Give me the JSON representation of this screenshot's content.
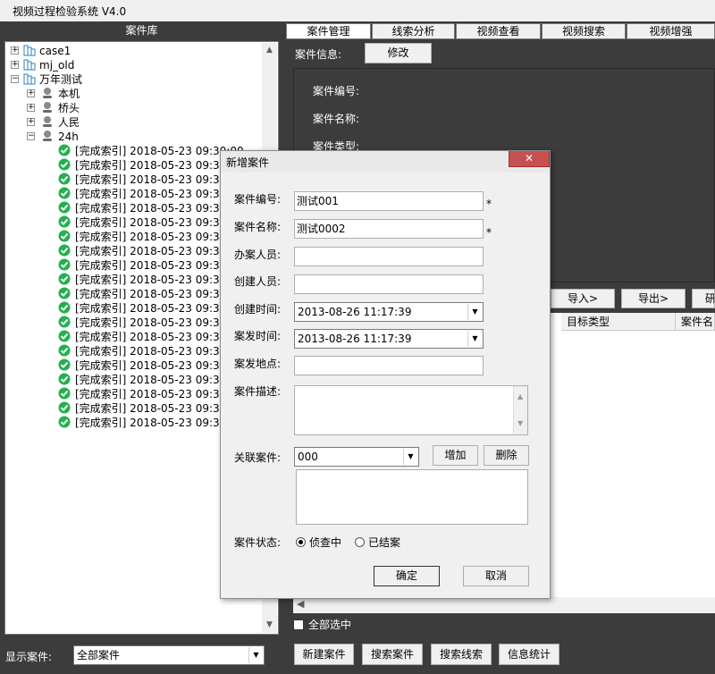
{
  "app": {
    "title": "视频过程检验系统 V4.0"
  },
  "left": {
    "header": "案件库",
    "tree": {
      "cases": [
        "case1",
        "mj_old",
        "万年测试"
      ],
      "cameras": [
        "本机",
        "桥头",
        "人民",
        "24h"
      ],
      "index_items": [
        "[完成索引] 2018-05-23 09:30:00",
        "[完成索引] 2018-05-23 09:30",
        "[完成索引] 2018-05-23 09:30",
        "[完成索引] 2018-05-23 09:30",
        "[完成索引] 2018-05-23 09:30",
        "[完成索引] 2018-05-23 09:30",
        "[完成索引] 2018-05-23 09:30",
        "[完成索引] 2018-05-23 09:30",
        "[完成索引] 2018-05-23 09:30",
        "[完成索引] 2018-05-23 09:30",
        "[完成索引] 2018-05-23 09:30",
        "[完成索引] 2018-05-23 09:30",
        "[完成索引] 2018-05-23 09:30",
        "[完成索引] 2018-05-23 09:30",
        "[完成索引] 2018-05-23 09:30",
        "[完成索引] 2018-05-23 09:30",
        "[完成索引] 2018-05-23 09:30",
        "[完成索引] 2018-05-23 09:30",
        "[完成索引] 2018-05-23 09:30",
        "[完成索引] 2018-05-23 09:30"
      ]
    },
    "footer": {
      "label": "显示案件:",
      "selected": "全部案件"
    }
  },
  "tabs": [
    "案件管理",
    "线索分析",
    "视频查看",
    "视频搜索",
    "视频增强"
  ],
  "case_info": {
    "label": "案件信息:",
    "edit_button": "修改",
    "fields": [
      "案件编号:",
      "案件名称:",
      "案件类型:"
    ]
  },
  "toolbar": {
    "import": "导入>",
    "export": "导出>",
    "more": "研"
  },
  "grid": {
    "columns": [
      "目标类型",
      "案件名"
    ]
  },
  "check_all": "全部选中",
  "bottom_buttons": [
    "新建案件",
    "搜索案件",
    "搜索线索",
    "信息统计"
  ],
  "dialog": {
    "title": "新增案件",
    "close": "✕",
    "labels": {
      "case_no": "案件编号:",
      "case_name": "案件名称:",
      "handler": "办案人员:",
      "creator": "创建人员:",
      "created_time": "创建时间:",
      "incident_time": "案发时间:",
      "location": "案发地点:",
      "description": "案件描述:",
      "related": "关联案件:",
      "status": "案件状态:"
    },
    "values": {
      "case_no": "测试001",
      "case_name": "测试0002",
      "handler": "",
      "creator": "",
      "created_time": "2013-08-26 11:17:39",
      "incident_time": "2013-08-26 11:17:39",
      "location": "",
      "related": "000"
    },
    "required_mark": "*",
    "add_button": "增加",
    "delete_button": "删除",
    "status_options": [
      "侦查中",
      "已结案"
    ],
    "ok_button": "确定",
    "cancel_button": "取消"
  }
}
